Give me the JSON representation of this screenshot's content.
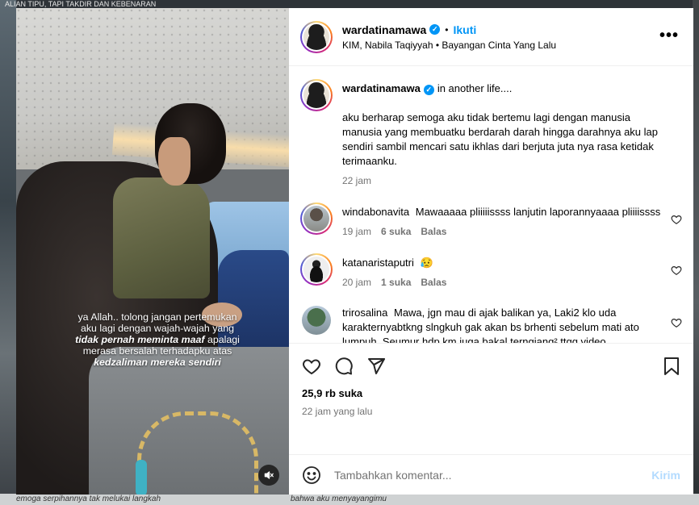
{
  "backdrop": {
    "top_text": "ALIAN TIPU, TAPI TAKDIR DAN KEBENARAN",
    "bottom_left": "emoga serpihannya tak melukai langkah",
    "bottom_right": "bahwa aku menyayangimu"
  },
  "media": {
    "caption_line1": "ya Allah.. tolong jangan pertemukan",
    "caption_line2": "aku lagi dengan wajah-wajah yang",
    "caption_em1": "tidak pernah meminta maaf",
    "caption_line3_rest": " apalagi",
    "caption_line4": "merasa bersalah terhadapku atas",
    "caption_em2": "kedzaliman mereka sendiri"
  },
  "header": {
    "username": "wardatinamawa",
    "verified": "✓",
    "dot": "•",
    "follow": "Ikuti",
    "subtitle": "KIM, Nabila Taqiyyah • Bayangan Cinta Yang Lalu",
    "more": "•••"
  },
  "post_caption": {
    "username": "wardatinamawa",
    "verified": "✓",
    "line1": "in another life....",
    "paragraph": "aku berharap semoga aku tidak bertemu lagi dengan manusia manusia yang membuatku berdarah darah hingga darahnya aku lap sendiri sambil mencari satu ikhlas dari berjuta juta nya rasa ketidak terimaanku.",
    "time": "22 jam"
  },
  "comments": [
    {
      "username": "windabonavita",
      "text": "Mawaaaaa pliiiiissss lanjutin laporannyaaaa pliiiissss",
      "time": "19 jam",
      "likes": "6 suka",
      "reply": "Balas"
    },
    {
      "username": "katanaristaputri",
      "text": "😥",
      "time": "20 jam",
      "likes": "1 suka",
      "reply": "Balas"
    },
    {
      "username": "trirosalina",
      "text": "Mawa, jgn mau di ajak balikan ya, Laki2 klo uda karakternyabtkng slngkuh gak akan bs brhenti sebelum mati ato lumpuh. Seumur hdp km juga bakal terngiang² ttgg video"
    }
  ],
  "actions": {
    "likes": "25,9 rb suka",
    "time_ago": "22 jam yang lalu"
  },
  "add_comment": {
    "placeholder": "Tambahkan komentar...",
    "post": "Kirim"
  }
}
